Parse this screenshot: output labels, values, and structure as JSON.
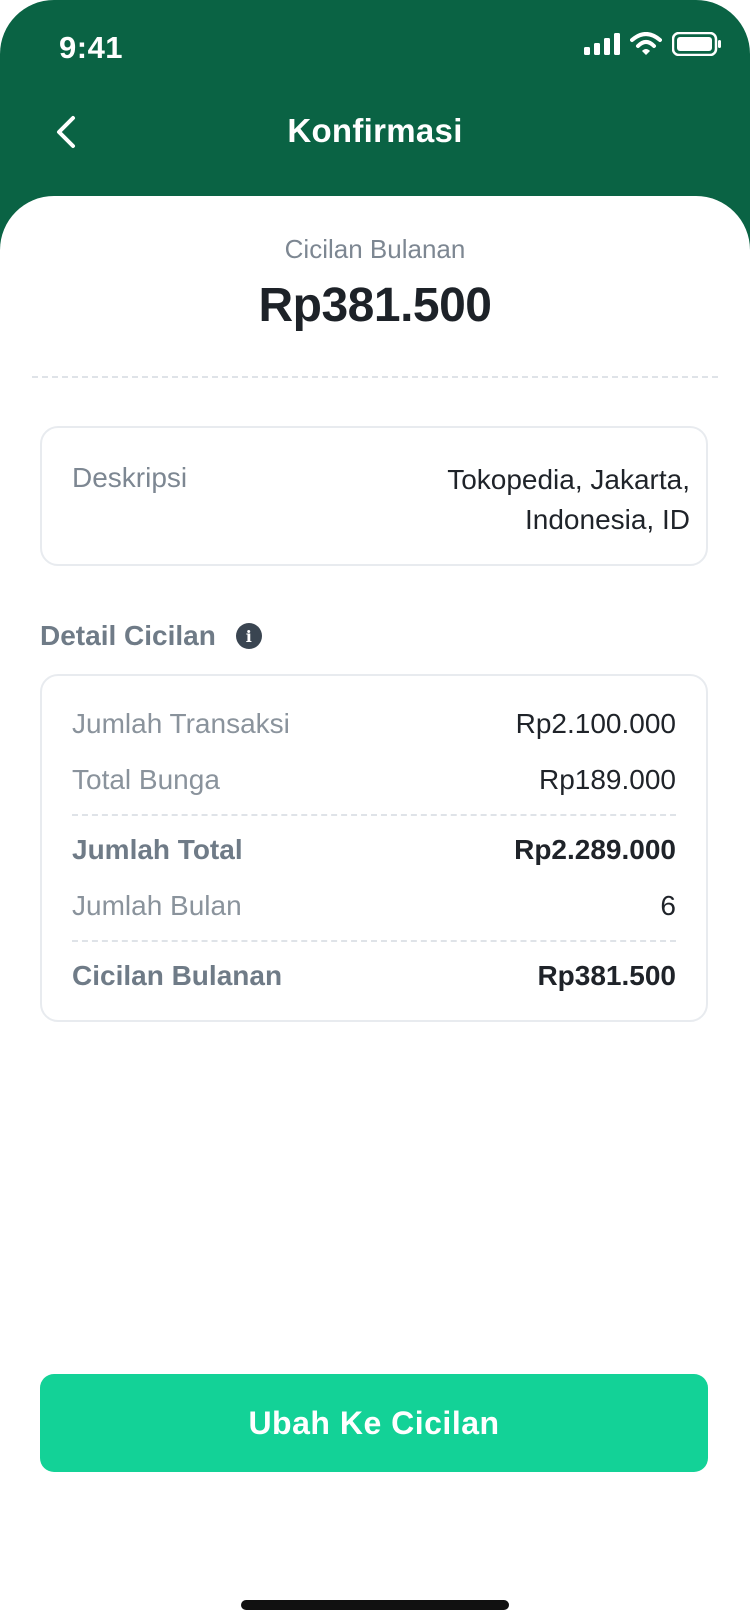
{
  "status_bar": {
    "time": "9:41",
    "icons": [
      "cellular-signal-icon",
      "wifi-icon",
      "battery-icon"
    ]
  },
  "nav": {
    "back_icon": "chevron-left-icon",
    "title": "Konfirmasi"
  },
  "summary": {
    "label": "Cicilan Bulanan",
    "amount": "Rp381.500"
  },
  "description": {
    "label": "Deskripsi",
    "value": "Tokopedia, Jakarta, Indonesia, ID"
  },
  "detail": {
    "title": "Detail Cicilan",
    "info_icon": "info-icon",
    "rows": [
      {
        "label": "Jumlah Transaksi",
        "value": "Rp2.100.000"
      },
      {
        "label": "Total Bunga",
        "value": "Rp189.000"
      },
      {
        "label": "Jumlah Total",
        "value": "Rp2.289.000"
      },
      {
        "label": "Jumlah Bulan",
        "value": "6"
      },
      {
        "label": "Cicilan Bulanan",
        "value": "Rp381.500"
      }
    ]
  },
  "cta": {
    "label": "Ubah Ke Cicilan"
  },
  "colors": {
    "header_green": "#0a6344",
    "cta_green": "#13d297",
    "muted_text": "#8a939c",
    "primary_text": "#1f2329"
  }
}
